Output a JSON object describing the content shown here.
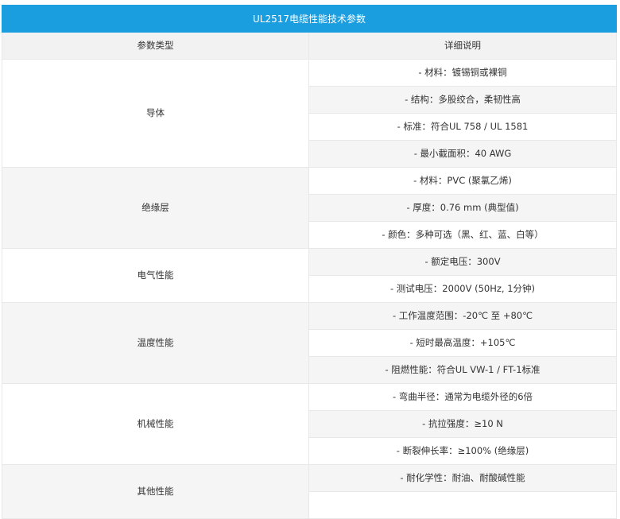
{
  "table": {
    "title": "UL2517电缆性能技术参数",
    "headers": [
      "参数类型",
      "详细说明"
    ],
    "groups": [
      {
        "category": "导体",
        "details": [
          "- 材料：镀锡铜或裸铜",
          "- 结构：多股绞合，柔韧性高",
          "- 标准：符合UL 758 / UL 1581",
          "- 最小截面积：40 AWG"
        ]
      },
      {
        "category": "绝缘层",
        "details": [
          "- 材料：PVC (聚氯乙烯)",
          "- 厚度：0.76 mm (典型值)",
          "- 颜色：多种可选（黑、红、蓝、白等）"
        ]
      },
      {
        "category": "电气性能",
        "details": [
          "- 额定电压：300V",
          "- 测试电压：2000V (50Hz, 1分钟)"
        ]
      },
      {
        "category": "温度性能",
        "details": [
          "- 工作温度范围：-20℃ 至 +80℃",
          "- 短时最高温度：+105℃",
          "- 阻燃性能：符合UL VW-1 / FT-1标准"
        ]
      },
      {
        "category": "机械性能",
        "details": [
          "- 弯曲半径：通常为电缆外径的6倍",
          "- 抗拉强度：≥10 N",
          "- 断裂伸长率：≥100% (绝缘层)"
        ]
      },
      {
        "category": "其他性能",
        "details": [
          "- 耐化学性：耐油、耐酸碱性能",
          ""
        ]
      }
    ]
  }
}
